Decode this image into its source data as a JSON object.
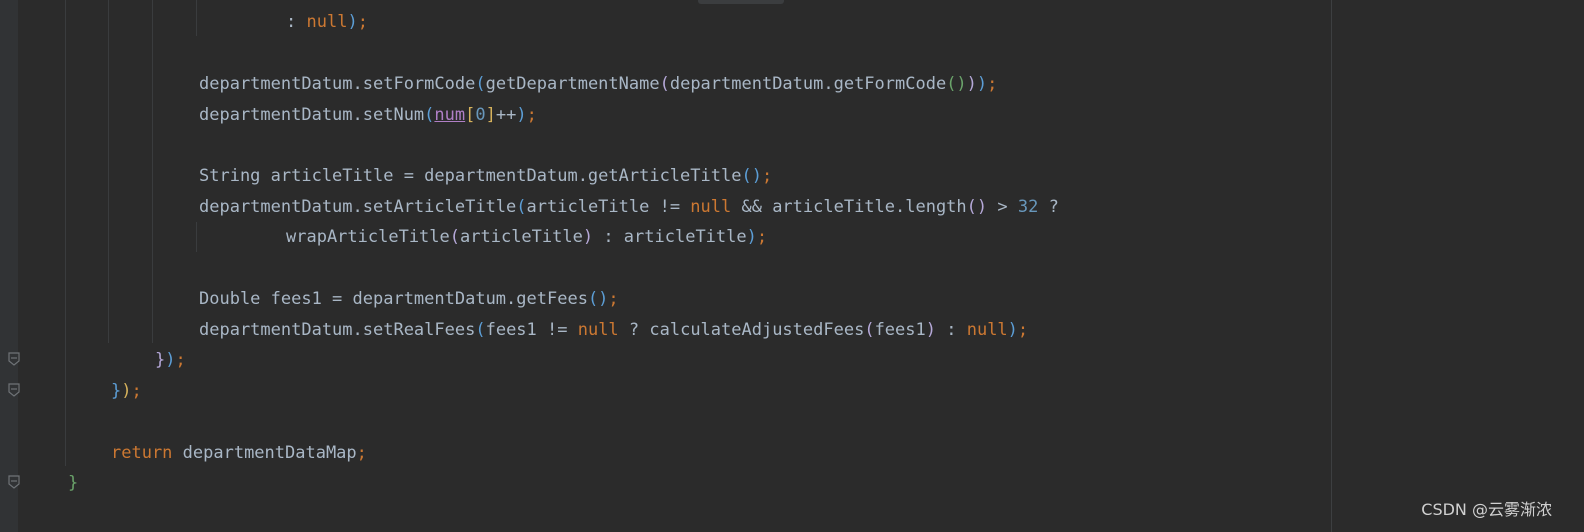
{
  "editor": {
    "lines": [
      {
        "text": ": null);"
      },
      {
        "text": "departmentDatum.setFormCode(getDepartmentName(departmentDatum.getFormCode()));"
      },
      {
        "text": "departmentDatum.setNum(num[0]++);"
      },
      {
        "text": "String articleTitle = departmentDatum.getArticleTitle();"
      },
      {
        "text": "departmentDatum.setArticleTitle(articleTitle != null && articleTitle.length() > 32 ?"
      },
      {
        "text": "wrapArticleTitle(articleTitle) : articleTitle);"
      },
      {
        "text": "Double fees1 = departmentDatum.getFees();"
      },
      {
        "text": "departmentDatum.setRealFees(fees1 != null ? calculateAdjustedFees(fees1) : null);"
      },
      {
        "text": "});"
      },
      {
        "text": "});"
      },
      {
        "text": "return departmentDataMap;"
      },
      {
        "text": "}"
      }
    ]
  },
  "watermark": {
    "text": "CSDN @云雾渐浓"
  },
  "colors": {
    "background": "#2b2b2b",
    "gutter": "#313335",
    "text": "#a9b7c6",
    "keyword": "#cc7832",
    "number": "#6897bb"
  }
}
